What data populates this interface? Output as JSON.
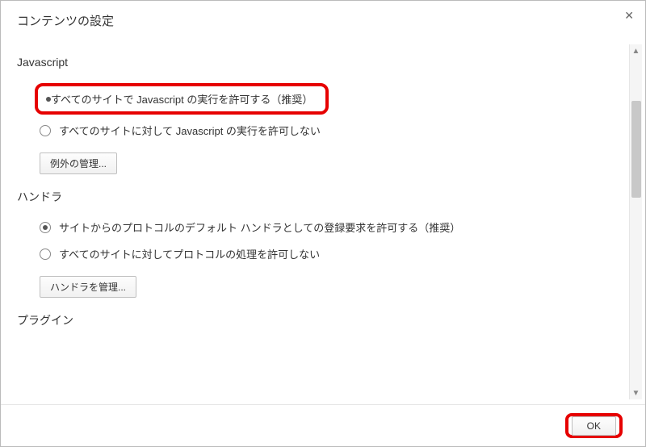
{
  "dialog": {
    "title": "コンテンツの設定",
    "close_label": "✕"
  },
  "sections": {
    "javascript": {
      "title": "Javascript",
      "option_allow": "すべてのサイトで Javascript の実行を許可する（推奨）",
      "option_block": "すべてのサイトに対して Javascript の実行を許可しない",
      "manage_button": "例外の管理..."
    },
    "handlers": {
      "title": "ハンドラ",
      "option_allow": "サイトからのプロトコルのデフォルト ハンドラとしての登録要求を許可する（推奨）",
      "option_block": "すべてのサイトに対してプロトコルの処理を許可しない",
      "manage_button": "ハンドラを管理..."
    },
    "plugins": {
      "title": "プラグイン"
    }
  },
  "footer": {
    "ok_label": "OK"
  },
  "scrollbar": {
    "up": "▲",
    "down": "▼"
  }
}
